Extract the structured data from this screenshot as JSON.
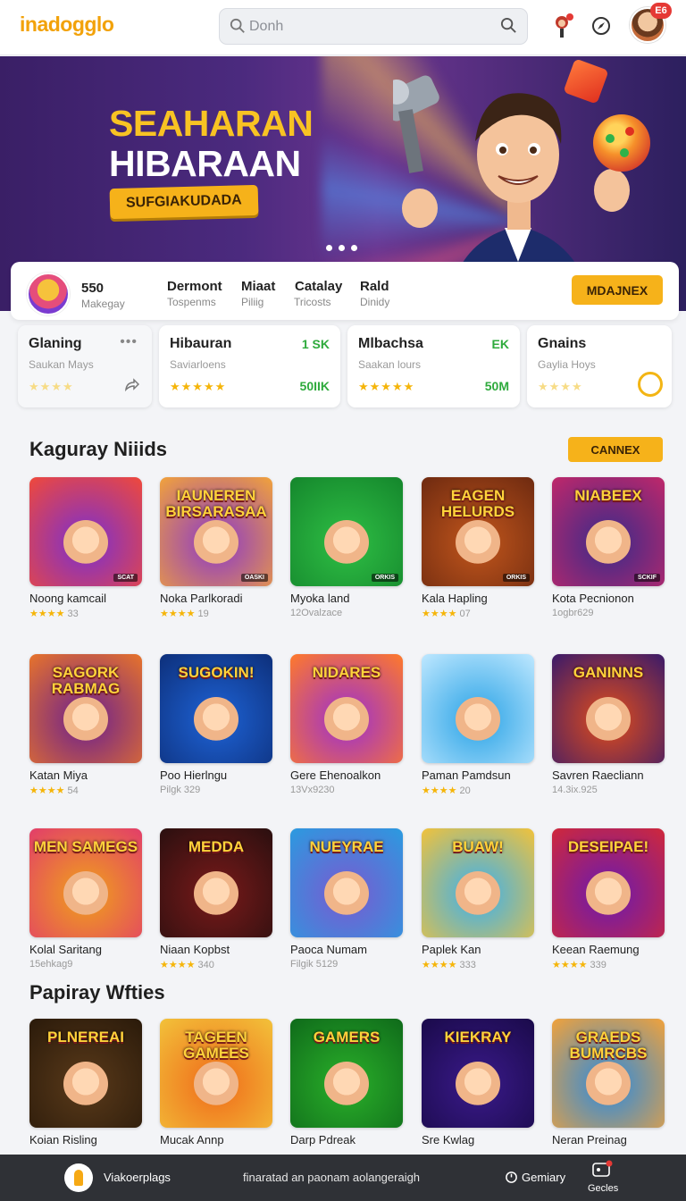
{
  "header": {
    "logo": "inadogglo",
    "search_placeholder": "Donh",
    "avatar_badge": "E6"
  },
  "hero": {
    "title_line1": "SEAHARAN",
    "title_line2": "HIBARAAN",
    "cta_label": "SUFGIAKUDADA",
    "slides": 3,
    "active_slide": 1
  },
  "stats": {
    "brand_value": "550",
    "brand_sub": "Makegay",
    "items": [
      {
        "value": "Dermont",
        "sub": "Tospenms"
      },
      {
        "value": "Miaat",
        "sub": "Piliig"
      },
      {
        "value": "Catalay",
        "sub": "Tricosts"
      },
      {
        "value": "Rald",
        "sub": "Dinidy"
      }
    ],
    "button_label": "MDAJNEX"
  },
  "cards": [
    {
      "title": "Glaning",
      "sub": "Saukan Mays",
      "top": "",
      "bottom": "",
      "stars": "★★★★"
    },
    {
      "title": "Hibauran",
      "sub": "Saviarloens",
      "top": "1 SK",
      "bottom": "50IIK",
      "stars": "★★★★★"
    },
    {
      "title": "Mlbachsa",
      "sub": "Saakan lours",
      "top": "EK",
      "bottom": "50M",
      "stars": "★★★★★"
    },
    {
      "title": "Gnains",
      "sub": "Gaylia Hoys",
      "top": "",
      "bottom": "",
      "stars": "★★★★"
    }
  ],
  "section1": {
    "title": "Kaguray Niiids",
    "button_label": "CANNEX"
  },
  "section2": {
    "title": "Papiray Wfties"
  },
  "games": [
    {
      "name": "Noong kamcail",
      "meta": "33",
      "stars": "★★★★",
      "thumb_text": "",
      "tag": "SCAT"
    },
    {
      "name": "Noka Parlkoradi",
      "meta": "19",
      "stars": "★★★★",
      "thumb_text": "IAUNEREN BIRSARASAA",
      "tag": "OASKI"
    },
    {
      "name": "Myoka land",
      "meta": "12Ovalzace",
      "stars": "",
      "thumb_text": "",
      "tag": "ORKIS"
    },
    {
      "name": "Kala Hapling",
      "meta": "07",
      "stars": "★★★★",
      "thumb_text": "EAGEN HELURDS",
      "tag": "ORKIS"
    },
    {
      "name": "Kota Pecnionon",
      "meta": "1ogbr629",
      "stars": "",
      "thumb_text": "NIABEEX",
      "tag": "SCKIF"
    },
    {
      "name": "Katan Miya",
      "meta": "54",
      "stars": "★★★★",
      "thumb_text": "SAGORK RABMAG",
      "tag": ""
    },
    {
      "name": "Poo Hierlngu",
      "meta": "Pilgk 329",
      "stars": "",
      "thumb_text": "SUGOKIN!",
      "tag": ""
    },
    {
      "name": "Gere Ehenoalkon",
      "meta": "13Vx9230",
      "stars": "",
      "thumb_text": "NIDARES",
      "tag": ""
    },
    {
      "name": "Paman Pamdsun",
      "meta": "20",
      "stars": "★★★★",
      "thumb_text": "",
      "tag": ""
    },
    {
      "name": "Savren Raecliann",
      "meta": "14.3ix.925",
      "stars": "",
      "thumb_text": "GANINNS",
      "tag": ""
    },
    {
      "name": "Kolal Saritang",
      "meta": "15ehkag9",
      "stars": "",
      "thumb_text": "MEN SAMEGS",
      "tag": ""
    },
    {
      "name": "Niaan Kopbst",
      "meta": "340",
      "stars": "★★★★",
      "thumb_text": "MEDDA",
      "tag": ""
    },
    {
      "name": "Paoca Numam",
      "meta": "Filgik 5129",
      "stars": "",
      "thumb_text": "NUEYRAE",
      "tag": ""
    },
    {
      "name": "Paplek Kan",
      "meta": "333",
      "stars": "★★★★",
      "thumb_text": "BUAW!",
      "tag": ""
    },
    {
      "name": "Keean Raemung",
      "meta": "339",
      "stars": "★★★★",
      "thumb_text": "DESEIPAE!",
      "tag": ""
    },
    {
      "name": "Koian Risling",
      "meta": "",
      "stars": "",
      "thumb_text": "PLNEREAI",
      "tag": ""
    },
    {
      "name": "Mucak Annp",
      "meta": "",
      "stars": "",
      "thumb_text": "TAGEEN GAMEES",
      "tag": ""
    },
    {
      "name": "Darp Pdreak",
      "meta": "",
      "stars": "",
      "thumb_text": "GAMERS",
      "tag": ""
    },
    {
      "name": "Sre Kwlag",
      "meta": "",
      "stars": "",
      "thumb_text": "KIEKRAY",
      "tag": ""
    },
    {
      "name": "Neran Preinag",
      "meta": "",
      "stars": "",
      "thumb_text": "GRAEDS BUMRCBS",
      "tag": ""
    }
  ],
  "bottom_bar": {
    "label": "Viakoerplags",
    "center_text": "finaratad an paonam aolangeraigh",
    "right_label": "Gemiary",
    "icon_label": "Gecles"
  },
  "colors": {
    "accent": "#f6b21a",
    "logo": "#f2a20a",
    "positive": "#2eaa3c",
    "bottom_bar": "#2f3136"
  }
}
